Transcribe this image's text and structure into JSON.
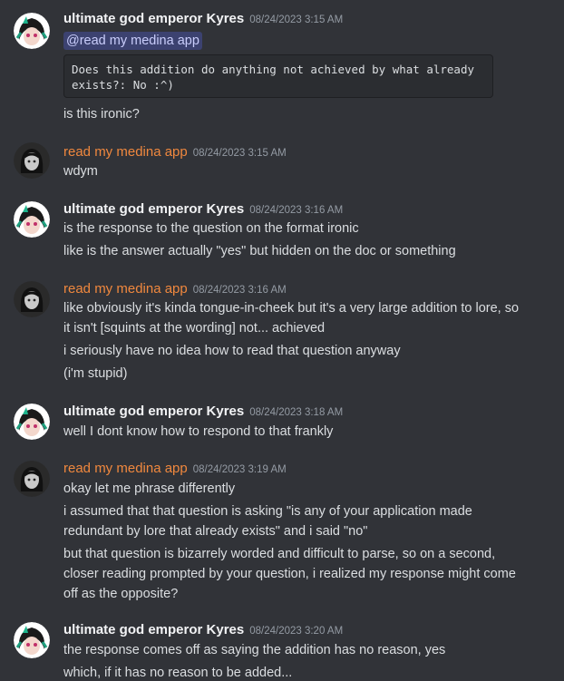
{
  "messages": [
    {
      "author": "ultimate god emperor Kyres",
      "timestamp": "08/24/2023 3:15 AM",
      "mention": "@read my medina app",
      "code": "Does this addition do anything not achieved by what already\nexists?: No :^)",
      "lines": [
        "is this ironic?"
      ]
    },
    {
      "author": "read my medina app",
      "timestamp": "08/24/2023 3:15 AM",
      "lines": [
        "wdym"
      ]
    },
    {
      "author": "ultimate god emperor Kyres",
      "timestamp": "08/24/2023 3:16 AM",
      "lines": [
        "is the response to the question on the format ironic",
        "like is the answer actually \"yes\" but hidden on the doc or something"
      ]
    },
    {
      "author": "read my medina app",
      "timestamp": "08/24/2023 3:16 AM",
      "lines": [
        "like obviously it's kinda tongue-in-cheek but it's a very large addition to lore, so",
        "it isn't [squints at the wording] not... achieved",
        "i seriously have no idea how to read that question anyway",
        "(i'm stupid)"
      ]
    },
    {
      "author": "ultimate god emperor Kyres",
      "timestamp": "08/24/2023 3:18 AM",
      "lines": [
        "well I dont know how to respond to that frankly"
      ]
    },
    {
      "author": "read my medina app",
      "timestamp": "08/24/2023 3:19 AM",
      "lines": [
        "okay let me phrase differently",
        "i assumed that that question is asking \"is any of your application made",
        "redundant by lore that already exists\" and i said \"no\"",
        "but that question is bizarrely worded and difficult to parse, so on a second,",
        "closer reading prompted by your question, i realized my response might come",
        "off as the opposite?"
      ]
    },
    {
      "author": "ultimate god emperor Kyres",
      "timestamp": "08/24/2023 3:20 AM",
      "lines": [
        "the response comes off as saying the addition has no reason, yes",
        "which, if it has no reason to be added..."
      ]
    }
  ]
}
